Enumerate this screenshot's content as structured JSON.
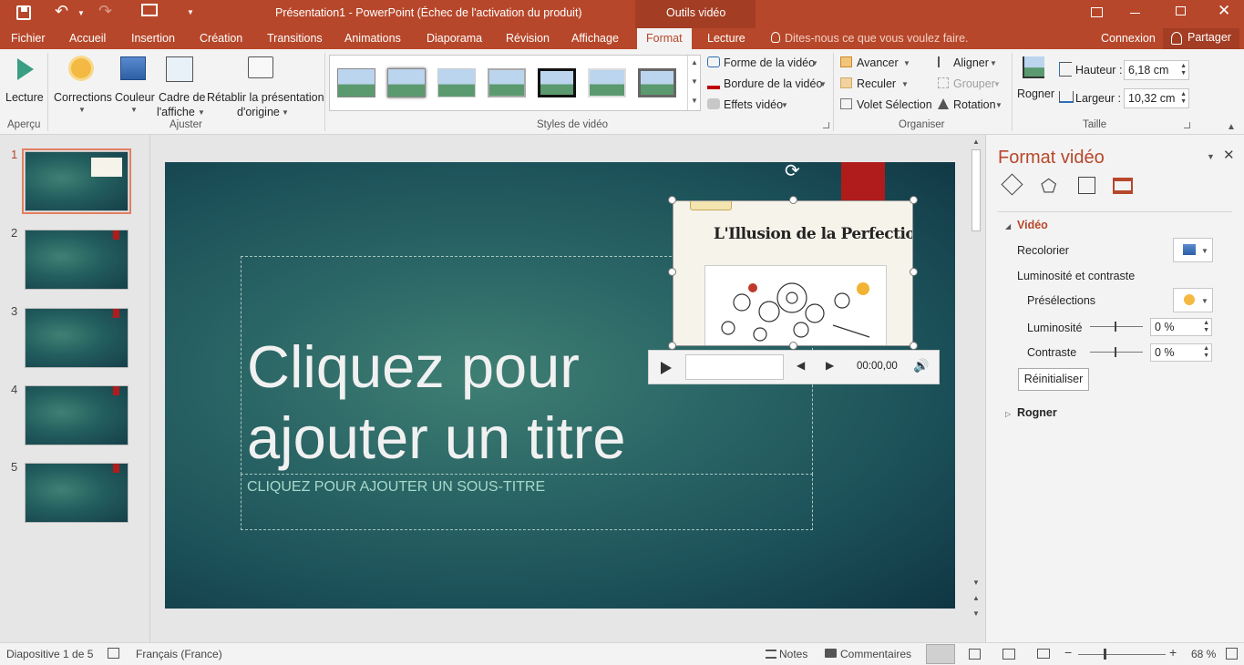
{
  "app": {
    "title": "Présentation1 - PowerPoint (Échec de l'activation du produit)",
    "context_tab": "Outils vidéo"
  },
  "tabs": [
    "Fichier",
    "Accueil",
    "Insertion",
    "Création",
    "Transitions",
    "Animations",
    "Diaporama",
    "Révision",
    "Affichage",
    "Format",
    "Lecture"
  ],
  "tell_me": "Dites-nous ce que vous voulez faire.",
  "account": {
    "signin": "Connexion",
    "share": "Partager"
  },
  "ribbon": {
    "preview": {
      "lecture": "Lecture",
      "group": "Aperçu"
    },
    "adjust": {
      "corrections": "Corrections",
      "couleur": "Couleur",
      "cadre1": "Cadre de",
      "cadre2": "l'affiche",
      "retablir1": "Rétablir la présentation",
      "retablir2": "d'origine",
      "group": "Ajuster"
    },
    "styles": {
      "group": "Styles de vidéo",
      "forme": "Forme de la vidéo",
      "bordure": "Bordure de la vidéo",
      "effets": "Effets vidéo"
    },
    "arrange": {
      "avancer": "Avancer",
      "reculer": "Reculer",
      "volet": "Volet Sélection",
      "aligner": "Aligner",
      "grouper": "Grouper",
      "rotation": "Rotation",
      "group": "Organiser"
    },
    "size": {
      "rogner": "Rogner",
      "hauteur_label": "Hauteur :",
      "hauteur": "6,18 cm",
      "largeur_label": "Largeur :",
      "largeur": "10,32 cm",
      "group": "Taille"
    }
  },
  "thumbnails": [
    "1",
    "2",
    "3",
    "4",
    "5"
  ],
  "slide": {
    "title": "Cliquez pour ajouter un titre",
    "subtitle": "CLIQUEZ POUR AJOUTER UN SOUS-TITRE",
    "video_title": "L'Illusion de la Perfection",
    "video_time": "00:00,00"
  },
  "pane": {
    "title": "Format vidéo",
    "section_video": "Vidéo",
    "recolorier": "Recolorier",
    "lum_contraste": "Luminosité et contraste",
    "preselections": "Présélections",
    "luminosite": "Luminosité",
    "luminosite_val": "0 %",
    "contraste": "Contraste",
    "contraste_val": "0 %",
    "reset": "Réinitialiser",
    "section_rogner": "Rogner"
  },
  "status": {
    "slide": "Diapositive 1 de 5",
    "language": "Français (France)",
    "notes": "Notes",
    "comments": "Commentaires",
    "zoom": "68 %"
  },
  "colors": {
    "accent": "#b7472a",
    "slide_dark": "#153f4a",
    "slide_light": "#3f8074",
    "red_bar": "#b01c1c"
  }
}
